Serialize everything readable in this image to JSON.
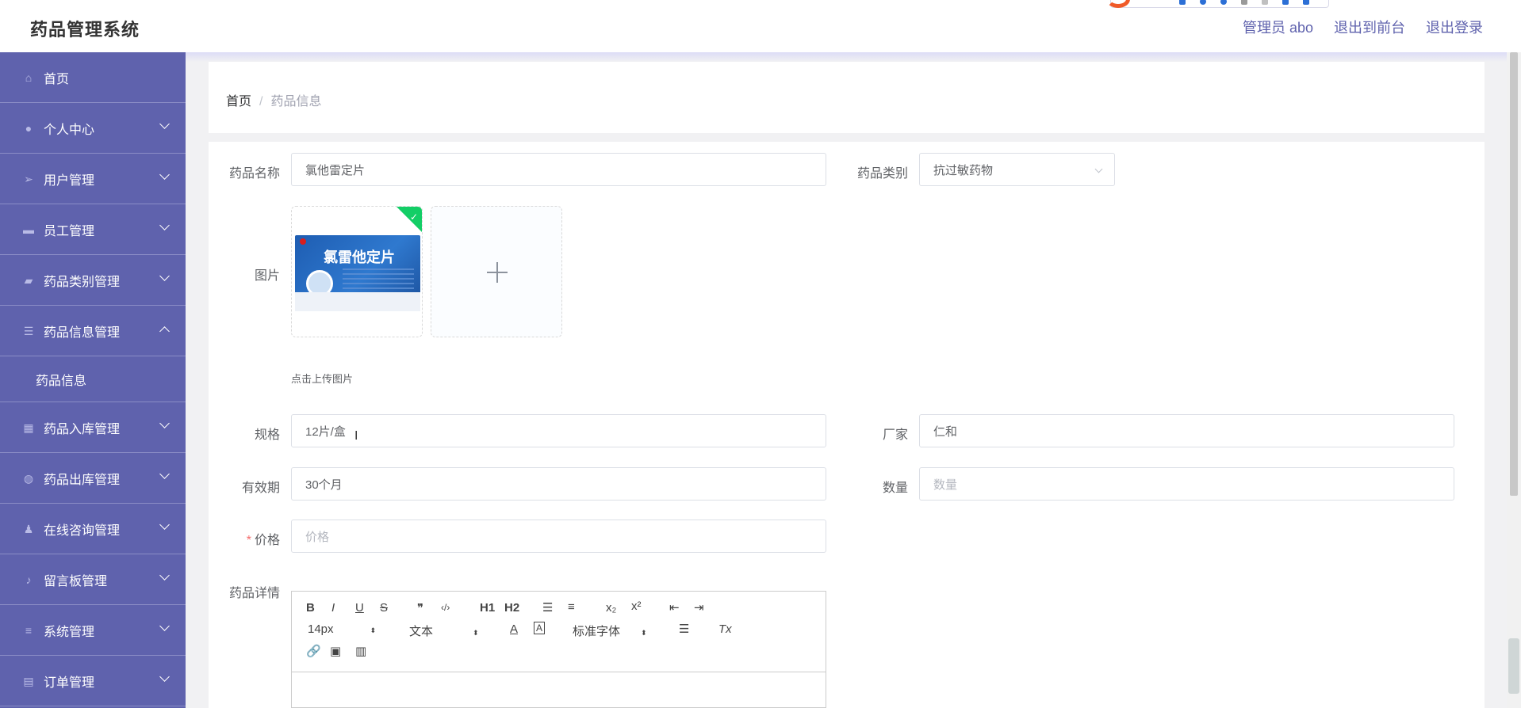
{
  "header": {
    "brand": "药品管理系统",
    "links": [
      "管理员 abo",
      "退出到前台",
      "退出登录"
    ]
  },
  "sidebar": {
    "items": [
      {
        "label": "首页",
        "icon": "home-icon",
        "expandable": false
      },
      {
        "label": "个人中心",
        "icon": "user-icon",
        "expandable": true
      },
      {
        "label": "用户管理",
        "icon": "send-icon",
        "expandable": true
      },
      {
        "label": "员工管理",
        "icon": "briefcase-icon",
        "expandable": true
      },
      {
        "label": "药品类别管理",
        "icon": "chat-icon",
        "expandable": true
      },
      {
        "label": "药品信息管理",
        "icon": "sliders-icon",
        "expandable": true,
        "expanded": true
      },
      {
        "label": "药品入库管理",
        "icon": "grid-icon",
        "expandable": true
      },
      {
        "label": "药品出库管理",
        "icon": "globe-icon",
        "expandable": true
      },
      {
        "label": "在线咨询管理",
        "icon": "stamp-icon",
        "expandable": true
      },
      {
        "label": "留言板管理",
        "icon": "microphone-icon",
        "expandable": true
      },
      {
        "label": "系统管理",
        "icon": "menu-icon",
        "expandable": true
      },
      {
        "label": "订单管理",
        "icon": "clipboard-icon",
        "expandable": true
      }
    ],
    "subitem": "药品信息"
  },
  "breadcrumb": {
    "home": "首页",
    "separator": "/",
    "current": "药品信息"
  },
  "form": {
    "name_label": "药品名称",
    "name_value": "氯他雷定片",
    "category_label": "药品类别",
    "category_value": "抗过敏药物",
    "image_label": "图片",
    "image_product_text": "氯雷他定片",
    "upload_tip": "点击上传图片",
    "spec_label": "规格",
    "spec_value": "12片/盒",
    "maker_label": "厂家",
    "maker_value": "仁和",
    "expiry_label": "有效期",
    "expiry_value": "30个月",
    "quantity_label": "数量",
    "quantity_placeholder": "数量",
    "price_required_mark": "*",
    "price_label": "价格",
    "price_placeholder": "价格",
    "detail_label": "药品详情"
  },
  "editor": {
    "row1": [
      "B",
      "I",
      "U",
      "S",
      "❞",
      "‹/›",
      "H1",
      "H2",
      "☰",
      "≡",
      "x₂",
      "x²",
      "⇤",
      "⇥"
    ],
    "font_size": "14px",
    "header_select": "文本",
    "font_family": "标准字体",
    "clear_format": "Tx"
  },
  "colors": {
    "sidebar_bg": "#5f62ad",
    "accent": "#5f62ad",
    "required": "#f56c6c",
    "success_badge": "#13ce66"
  }
}
